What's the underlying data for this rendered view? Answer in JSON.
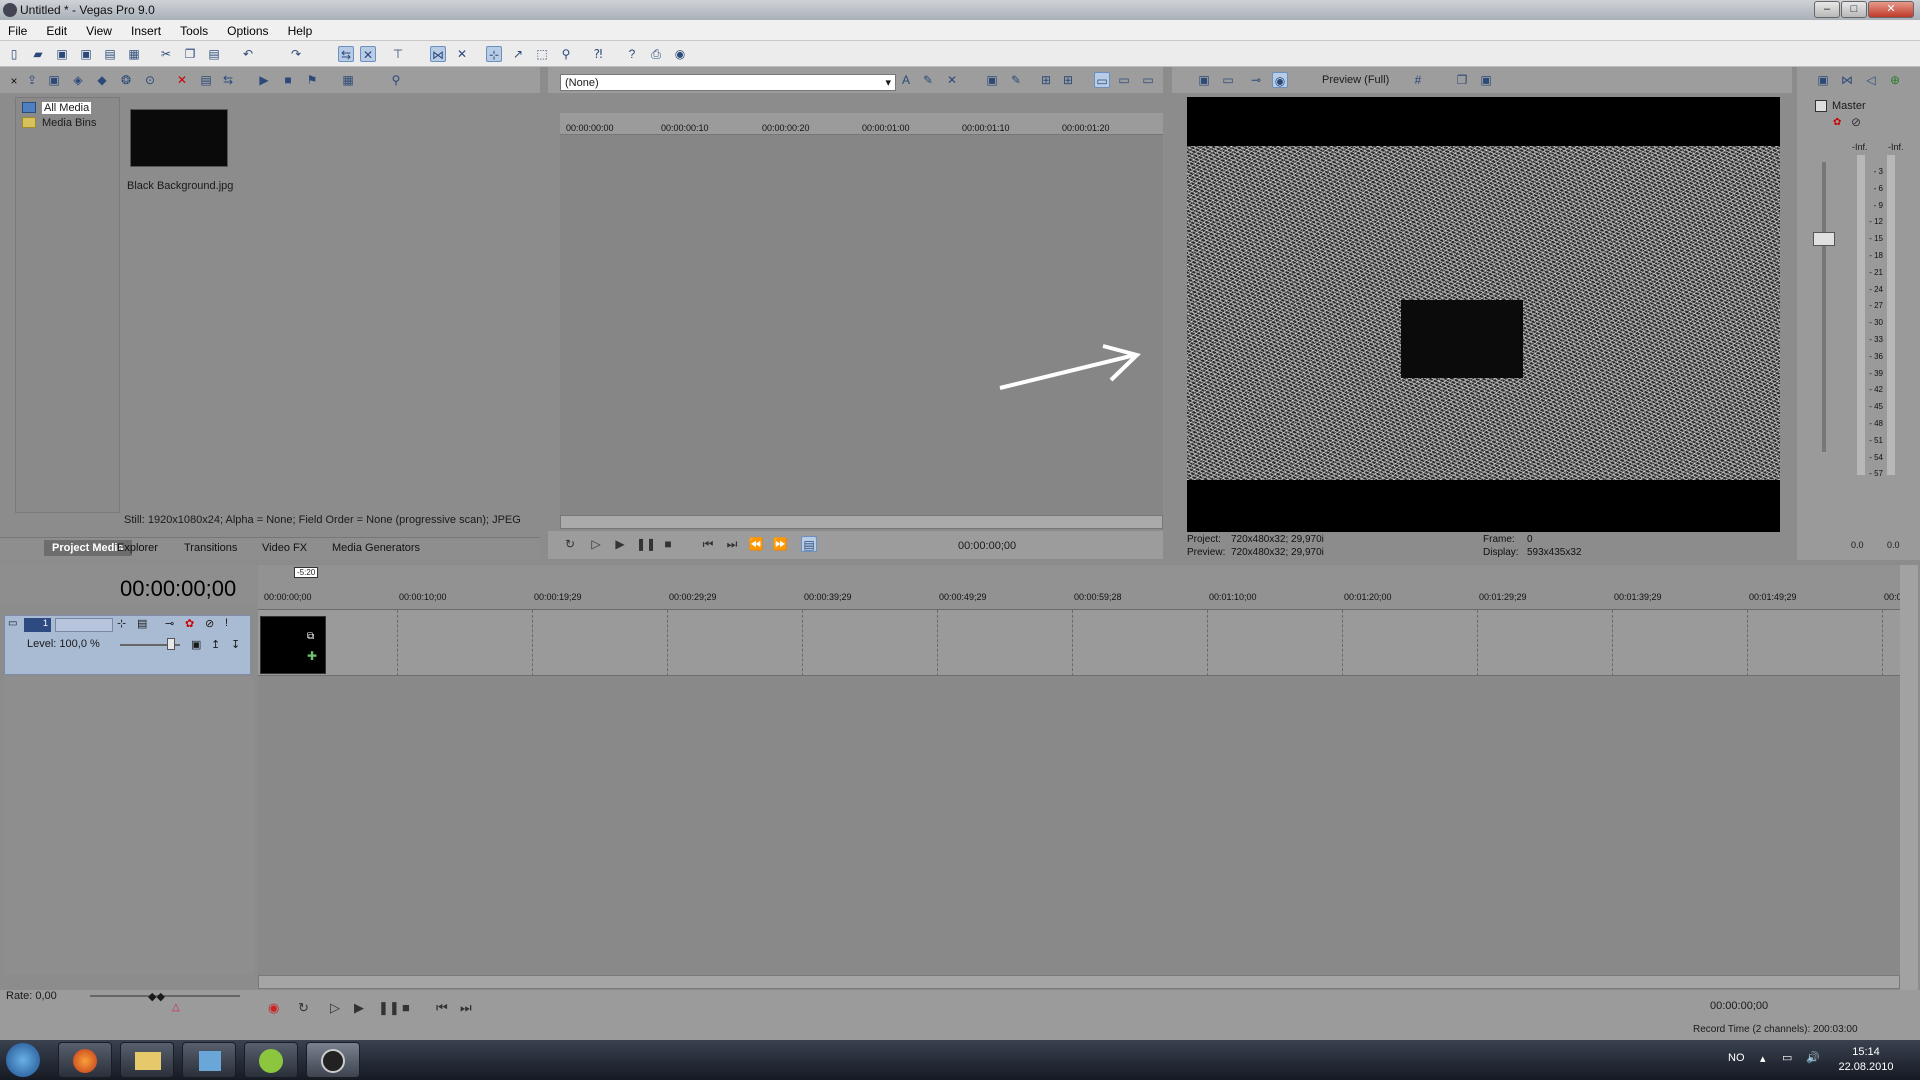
{
  "window": {
    "title": "Untitled * - Vegas Pro 9.0"
  },
  "menu": [
    "File",
    "Edit",
    "View",
    "Insert",
    "Tools",
    "Options",
    "Help"
  ],
  "project_media": {
    "tree": [
      "All Media",
      "Media Bins"
    ],
    "file_name": "Black Background.jpg",
    "status": "Still: 1920x1080x24; Alpha = None; Field Order = None (progressive scan); JPEG",
    "tabs": [
      "Project Media",
      "Explorer",
      "Transitions",
      "Video FX",
      "Media Generators"
    ]
  },
  "trimmer": {
    "selection": "(None)",
    "ruler": [
      "00:00:00:00",
      "00:00:00:10",
      "00:00:00:20",
      "00:00:01:00",
      "00:00:01:10",
      "00:00:01:20"
    ],
    "timecode": "00:00:00;00"
  },
  "preview": {
    "mode": "Preview (Full)",
    "project_label": "Project:",
    "project_value": "720x480x32; 29,970i",
    "preview_label": "Preview:",
    "preview_value": "720x480x32; 29,970i",
    "frame_label": "Frame:",
    "frame_value": "0",
    "display_label": "Display:",
    "display_value": "593x435x32"
  },
  "mixer": {
    "title": "Master",
    "inf_left": "-Inf.",
    "inf_right": "-Inf.",
    "scale": [
      "3",
      "6",
      "9",
      "12",
      "15",
      "18",
      "21",
      "24",
      "27",
      "30",
      "33",
      "36",
      "39",
      "42",
      "45",
      "48",
      "51",
      "54",
      "57"
    ],
    "value_left": "0.0",
    "value_right": "0.0"
  },
  "timeline": {
    "timecode": "00:00:00;00",
    "marker": "-5:20",
    "level": "Level: 100,0 %",
    "track_number": "1",
    "ruler": [
      "00:00:00;00",
      "00:00:10;00",
      "00:00:19;29",
      "00:00:29;29",
      "00:00:39;29",
      "00:00:49;29",
      "00:00:59;28",
      "00:01:10;00",
      "00:01:20;00",
      "00:01:29;29",
      "00:01:39;29",
      "00:01:49;29",
      "00:0"
    ]
  },
  "transport": {
    "rate": "Rate: 0,00",
    "timecode": "00:00:00;00",
    "record_time": "Record Time (2 channels): 200:03:00"
  },
  "taskbar": {
    "lang": "NO",
    "time": "15:14",
    "date": "22.08.2010"
  }
}
